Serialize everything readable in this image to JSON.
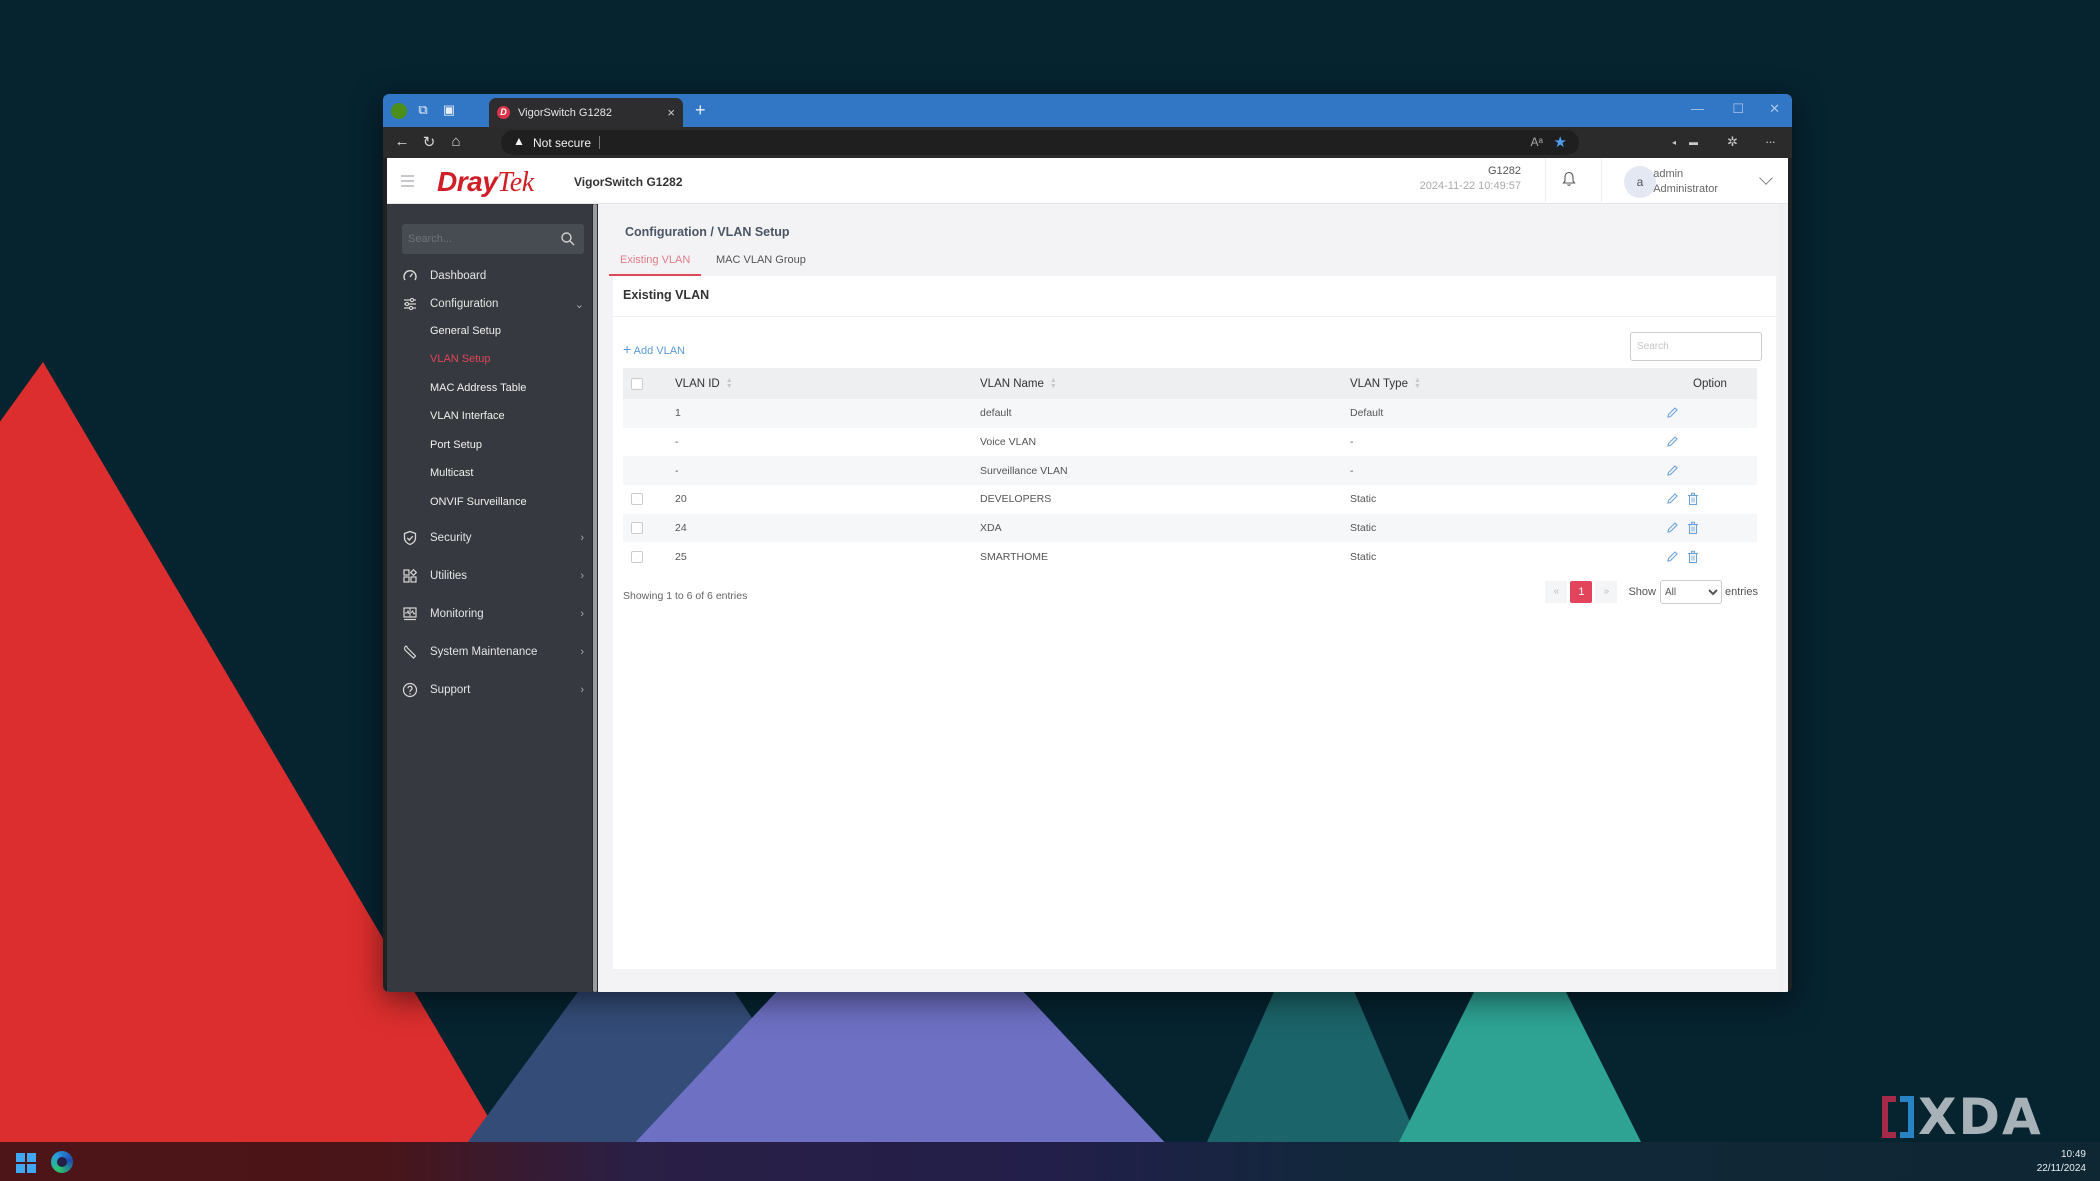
{
  "browser": {
    "tab_title": "VigorSwitch G1282",
    "tab_favicon": "D",
    "address_security_label": "Not secure",
    "new_tab_symbol": "+",
    "close_tab_symbol": "×",
    "read_aloud_symbol": "Aᵃ",
    "favorite_symbol": "★",
    "more_symbol": "···",
    "window_controls": {
      "minimize": "—",
      "maximize": "☐",
      "close": "✕"
    }
  },
  "app_header": {
    "logo_part1": "Dray",
    "logo_part2": "Tek",
    "model": "VigorSwitch G1282",
    "device_name": "G1282",
    "datetime": "2024-11-22 10:49:57",
    "avatar_initial": "a",
    "user_name": "admin",
    "user_role": "Administrator"
  },
  "sidebar": {
    "search_placeholder": "Search...",
    "items": [
      {
        "label": "Dashboard",
        "icon": "dashboard-gauge-icon"
      },
      {
        "label": "Configuration",
        "icon": "sliders-icon",
        "expanded": true,
        "children": [
          {
            "label": "General Setup",
            "active": false
          },
          {
            "label": "VLAN Setup",
            "active": true
          },
          {
            "label": "MAC Address Table",
            "active": false
          },
          {
            "label": "VLAN Interface",
            "active": false
          },
          {
            "label": "Port Setup",
            "active": false
          },
          {
            "label": "Multicast",
            "active": false
          },
          {
            "label": "ONVIF Surveillance",
            "active": false
          }
        ]
      },
      {
        "label": "Security",
        "icon": "shield-check-icon"
      },
      {
        "label": "Utilities",
        "icon": "grid-apps-icon"
      },
      {
        "label": "Monitoring",
        "icon": "monitor-chart-icon"
      },
      {
        "label": "System Maintenance",
        "icon": "wrench-icon"
      },
      {
        "label": "Support",
        "icon": "help-circle-icon"
      }
    ]
  },
  "main": {
    "breadcrumb": "Configuration /  VLAN Setup",
    "tabs": [
      {
        "label": "Existing VLAN",
        "active": true
      },
      {
        "label": "MAC VLAN Group",
        "active": false
      }
    ],
    "card_title": "Existing VLAN",
    "add_button_label": "Add VLAN",
    "search_placeholder": "Search",
    "table": {
      "columns": [
        "VLAN ID",
        "VLAN Name",
        "VLAN Type",
        "Option"
      ],
      "rows": [
        {
          "id": "1",
          "name": "default",
          "type": "Default",
          "selectable": false,
          "deletable": false
        },
        {
          "id": "-",
          "name": "Voice VLAN",
          "type": "-",
          "selectable": false,
          "deletable": false
        },
        {
          "id": "-",
          "name": "Surveillance VLAN",
          "type": "-",
          "selectable": false,
          "deletable": false
        },
        {
          "id": "20",
          "name": "DEVELOPERS",
          "type": "Static",
          "selectable": true,
          "deletable": true
        },
        {
          "id": "24",
          "name": "XDA",
          "type": "Static",
          "selectable": true,
          "deletable": true
        },
        {
          "id": "25",
          "name": "SMARTHOME",
          "type": "Static",
          "selectable": true,
          "deletable": true
        }
      ]
    },
    "info": "Showing 1 to 6 of 6 entries",
    "pagination": {
      "prev": "«",
      "current": "1",
      "next": "»",
      "show_label": "Show",
      "page_size": "All",
      "entries_label": "entries"
    }
  },
  "taskbar": {
    "time": "10:49",
    "date": "22/11/2024"
  },
  "watermark": "XDA",
  "colors": {
    "brand_red": "#d01e27",
    "active_accent": "#e0455a",
    "link_blue": "#5a9ad7",
    "sidebar_bg": "#36393f",
    "tabbar_blue": "#3277c5"
  }
}
